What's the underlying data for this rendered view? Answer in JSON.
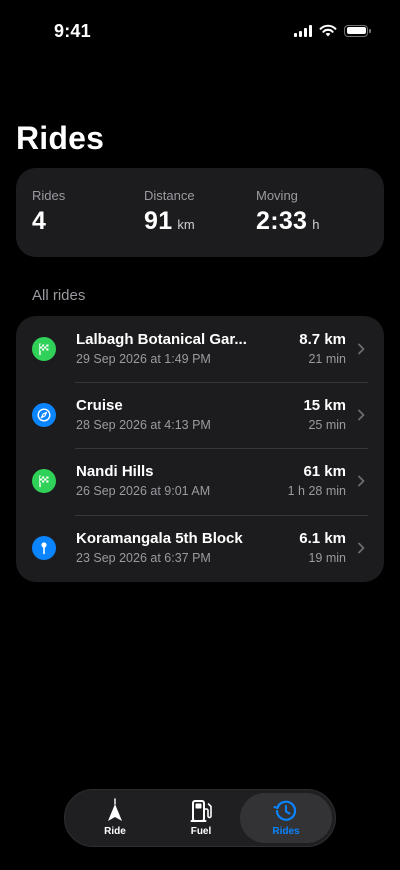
{
  "status_bar": {
    "time": "9:41"
  },
  "page": {
    "title": "Rides"
  },
  "summary": {
    "rides": {
      "label": "Rides",
      "value": "4",
      "unit": ""
    },
    "distance": {
      "label": "Distance",
      "value": "91",
      "unit": "km"
    },
    "moving": {
      "label": "Moving",
      "value": "2:33",
      "unit": "h"
    }
  },
  "list": {
    "section_title": "All rides",
    "rides": [
      {
        "name": "Lalbagh Botanical Gar...",
        "date": "29 Sep 2026 at 1:49 PM",
        "distance": "8.7 km",
        "duration": "21 min",
        "icon": "flag-icon",
        "color": "#30d158"
      },
      {
        "name": "Cruise",
        "date": "28 Sep 2026 at 4:13 PM",
        "distance": "15 km",
        "duration": "25 min",
        "icon": "compass-icon",
        "color": "#0a84ff"
      },
      {
        "name": "Nandi Hills",
        "date": "26 Sep 2026 at 9:01 AM",
        "distance": "61 km",
        "duration": "1 h 28 min",
        "icon": "flag-icon",
        "color": "#30d158"
      },
      {
        "name": "Koramangala 5th Block",
        "date": "23 Sep 2026 at 6:37 PM",
        "distance": "6.1 km",
        "duration": "19 min",
        "icon": "pin-icon",
        "color": "#0a84ff"
      }
    ]
  },
  "tabs": [
    {
      "label": "Ride",
      "icon": "navigation-arrow-icon",
      "active": false
    },
    {
      "label": "Fuel",
      "icon": "fuel-pump-icon",
      "active": false
    },
    {
      "label": "Rides",
      "icon": "history-clock-icon",
      "active": true
    }
  ],
  "colors": {
    "accent": "#0a84ff",
    "green": "#30d158",
    "card": "#1c1c1e",
    "secondary_text": "#9a9aa0"
  }
}
